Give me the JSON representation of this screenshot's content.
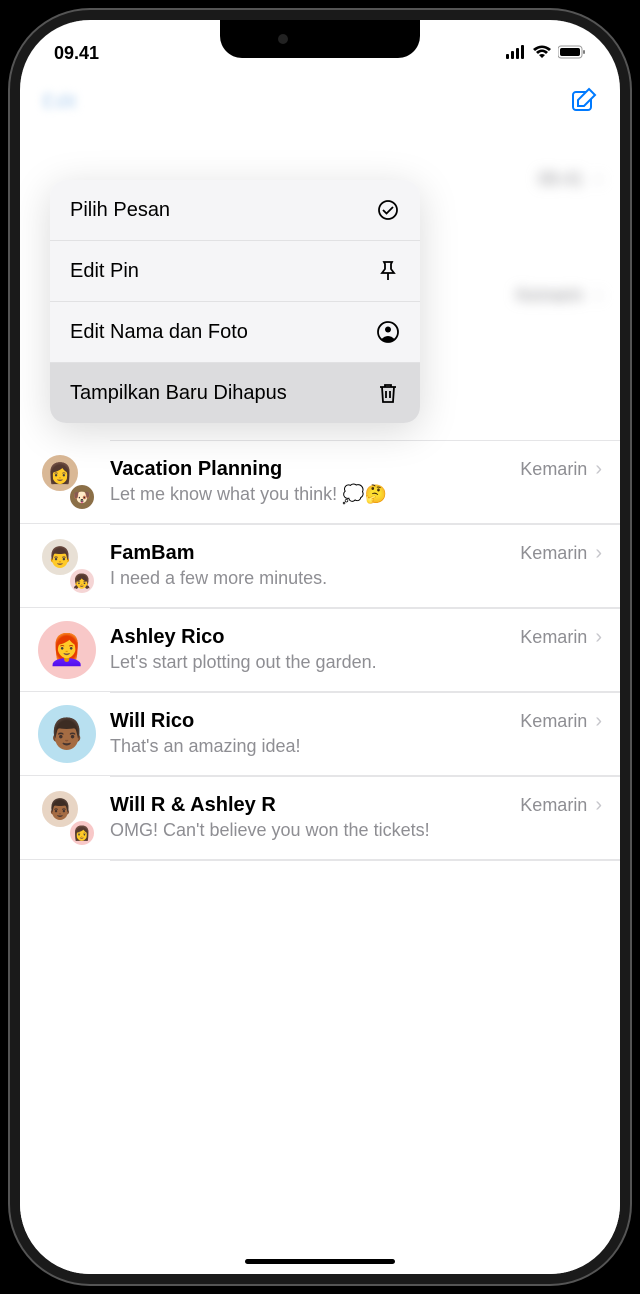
{
  "status": {
    "time": "09.41"
  },
  "nav": {
    "edit": "Edit"
  },
  "menu": {
    "items": [
      {
        "label": "Pilih Pesan",
        "icon": "check-circle"
      },
      {
        "label": "Edit Pin",
        "icon": "pin"
      },
      {
        "label": "Edit Nama dan Foto",
        "icon": "person-circle"
      },
      {
        "label": "Tampilkan Baru Dihapus",
        "icon": "trash"
      }
    ]
  },
  "peek": {
    "row1_time": "09.41",
    "row2_time": "Kemarin"
  },
  "conversations": [
    {
      "name": "Vacation Planning",
      "time": "Kemarin",
      "preview": "Let me know what you think! 💭🤔"
    },
    {
      "name": "FamBam",
      "time": "Kemarin",
      "preview": "I need a few more minutes."
    },
    {
      "name": "Ashley Rico",
      "time": "Kemarin",
      "preview": "Let's start plotting out the garden."
    },
    {
      "name": "Will Rico",
      "time": "Kemarin",
      "preview": "That's an amazing idea!"
    },
    {
      "name": "Will R & Ashley R",
      "time": "Kemarin",
      "preview": "OMG! Can't believe you won the tickets!"
    }
  ]
}
